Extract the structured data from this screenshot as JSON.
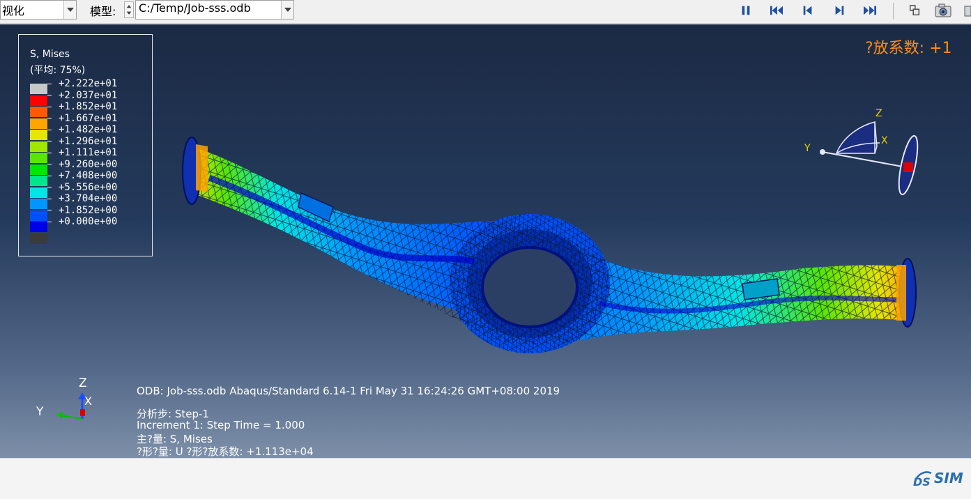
{
  "toolbar": {
    "module_label": "视化",
    "model_label": "模型:",
    "model_value": "C:/Temp/Job-sss.odb",
    "icons": [
      "pause-icon",
      "first-frame-icon",
      "previous-frame-icon",
      "next-frame-icon",
      "last-frame-icon",
      "copy-viewport-icon",
      "camera-icon"
    ]
  },
  "legend": {
    "title": "S, Mises",
    "subtitle": "(平均: 75%)",
    "entries": [
      {
        "label": "+2.222e+01",
        "color": "#c8c8c8"
      },
      {
        "label": "+2.037e+01",
        "color": "#ff0000"
      },
      {
        "label": "+1.852e+01",
        "color": "#ff5a00"
      },
      {
        "label": "+1.667e+01",
        "color": "#ffa500"
      },
      {
        "label": "+1.482e+01",
        "color": "#e6e600"
      },
      {
        "label": "+1.296e+01",
        "color": "#a0e600"
      },
      {
        "label": "+1.111e+01",
        "color": "#5ae600"
      },
      {
        "label": "+9.260e+00",
        "color": "#00e600"
      },
      {
        "label": "+7.408e+00",
        "color": "#00e68c"
      },
      {
        "label": "+5.556e+00",
        "color": "#00e6e6"
      },
      {
        "label": "+3.704e+00",
        "color": "#0096ff"
      },
      {
        "label": "+1.852e+00",
        "color": "#0050ff"
      },
      {
        "label": "+0.000e+00",
        "color": "#0000e6"
      },
      {
        "label": "",
        "color": "#3a3a3a"
      }
    ]
  },
  "viewport": {
    "deform_factor_text": "?放系数: +1",
    "triad_labels": {
      "z": "Z",
      "y": "Y",
      "x": "X"
    },
    "mini_axes_labels": {
      "z": "Z",
      "y": "Y",
      "x": "X"
    }
  },
  "info": {
    "line1": "ODB: Job-sss.odb    Abaqus/Standard 6.14-1    Fri May 31 16:24:26 GMT+08:00 2019",
    "line2": "分析步: Step-1",
    "line3": "Increment     1: Step Time =    1.000",
    "line4": "主?量: S, Mises",
    "line5": "?形?量: U   ?形?放系数: +1.113e+04"
  },
  "footer": {
    "logo_text": "SIM"
  }
}
